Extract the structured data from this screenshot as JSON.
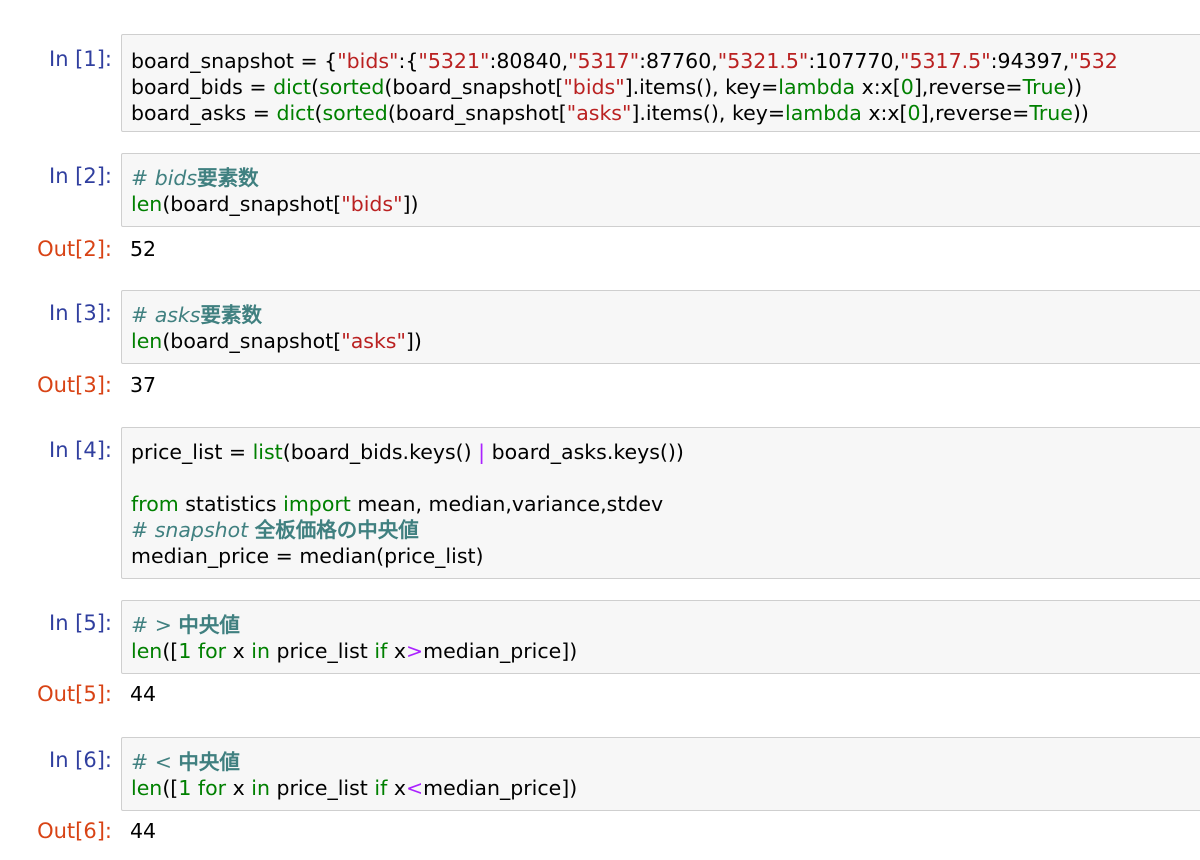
{
  "cells": [
    {
      "prompt": "In [1]:",
      "lines": [
        [
          {
            "t": "board_snapshot = {",
            "c": ""
          },
          {
            "t": "\"bids\"",
            "c": "s"
          },
          {
            "t": ":{",
            "c": ""
          },
          {
            "t": "\"5321\"",
            "c": "s"
          },
          {
            "t": ":80840,",
            "c": ""
          },
          {
            "t": "\"5317\"",
            "c": "s"
          },
          {
            "t": ":87760,",
            "c": ""
          },
          {
            "t": "\"5321.5\"",
            "c": "s"
          },
          {
            "t": ":107770,",
            "c": ""
          },
          {
            "t": "\"5317.5\"",
            "c": "s"
          },
          {
            "t": ":94397,",
            "c": ""
          },
          {
            "t": "\"532",
            "c": "s"
          }
        ],
        [
          {
            "t": "board_bids = ",
            "c": ""
          },
          {
            "t": "dict",
            "c": "b"
          },
          {
            "t": "(",
            "c": ""
          },
          {
            "t": "sorted",
            "c": "b"
          },
          {
            "t": "(board_snapshot[",
            "c": ""
          },
          {
            "t": "\"bids\"",
            "c": "s"
          },
          {
            "t": "].items(), key=",
            "c": ""
          },
          {
            "t": "lambda",
            "c": "k"
          },
          {
            "t": " x:x[",
            "c": ""
          },
          {
            "t": "0",
            "c": "num"
          },
          {
            "t": "],reverse=",
            "c": ""
          },
          {
            "t": "True",
            "c": "k"
          },
          {
            "t": "))",
            "c": ""
          }
        ],
        [
          {
            "t": "board_asks = ",
            "c": ""
          },
          {
            "t": "dict",
            "c": "b"
          },
          {
            "t": "(",
            "c": ""
          },
          {
            "t": "sorted",
            "c": "b"
          },
          {
            "t": "(board_snapshot[",
            "c": ""
          },
          {
            "t": "\"asks\"",
            "c": "s"
          },
          {
            "t": "].items(), key=",
            "c": ""
          },
          {
            "t": "lambda",
            "c": "k"
          },
          {
            "t": " x:x[",
            "c": ""
          },
          {
            "t": "0",
            "c": "num"
          },
          {
            "t": "],reverse=",
            "c": ""
          },
          {
            "t": "True",
            "c": "k"
          },
          {
            "t": "))",
            "c": ""
          }
        ]
      ],
      "output_prompt": "",
      "output": ""
    },
    {
      "prompt": "In [2]:",
      "lines": [
        [
          {
            "t": "# bids",
            "c": "c"
          },
          {
            "t": "要素数",
            "c": "cj"
          }
        ],
        [
          {
            "t": "len",
            "c": "b"
          },
          {
            "t": "(board_snapshot[",
            "c": ""
          },
          {
            "t": "\"bids\"",
            "c": "s"
          },
          {
            "t": "])",
            "c": ""
          }
        ]
      ],
      "output_prompt": "Out[2]:",
      "output": "52"
    },
    {
      "prompt": "In [3]:",
      "lines": [
        [
          {
            "t": "# asks",
            "c": "c"
          },
          {
            "t": "要素数",
            "c": "cj"
          }
        ],
        [
          {
            "t": "len",
            "c": "b"
          },
          {
            "t": "(board_snapshot[",
            "c": ""
          },
          {
            "t": "\"asks\"",
            "c": "s"
          },
          {
            "t": "])",
            "c": ""
          }
        ]
      ],
      "output_prompt": "Out[3]:",
      "output": "37"
    },
    {
      "prompt": "In [4]:",
      "lines": [
        [
          {
            "t": "price_list = ",
            "c": ""
          },
          {
            "t": "list",
            "c": "b"
          },
          {
            "t": "(board_bids.keys() ",
            "c": ""
          },
          {
            "t": "|",
            "c": "o"
          },
          {
            "t": " board_asks.keys())",
            "c": ""
          }
        ],
        [],
        [
          {
            "t": "from",
            "c": "k"
          },
          {
            "t": " statistics ",
            "c": ""
          },
          {
            "t": "import",
            "c": "k"
          },
          {
            "t": " mean, median,variance,stdev",
            "c": ""
          }
        ],
        [
          {
            "t": "# snapshot ",
            "c": "c"
          },
          {
            "t": "全板価格の中央値",
            "c": "cj"
          }
        ],
        [
          {
            "t": "median_price = median(price_list)",
            "c": ""
          }
        ]
      ],
      "output_prompt": "",
      "output": ""
    },
    {
      "prompt": "In [5]:",
      "lines": [
        [
          {
            "t": "# > ",
            "c": "c"
          },
          {
            "t": "中央値",
            "c": "cj"
          }
        ],
        [
          {
            "t": "len",
            "c": "b"
          },
          {
            "t": "([",
            "c": ""
          },
          {
            "t": "1",
            "c": "num"
          },
          {
            "t": " ",
            "c": ""
          },
          {
            "t": "for",
            "c": "k"
          },
          {
            "t": " x ",
            "c": ""
          },
          {
            "t": "in",
            "c": "k"
          },
          {
            "t": " price_list ",
            "c": ""
          },
          {
            "t": "if",
            "c": "k"
          },
          {
            "t": " x",
            "c": ""
          },
          {
            "t": ">",
            "c": "o"
          },
          {
            "t": "median_price])",
            "c": ""
          }
        ]
      ],
      "output_prompt": "Out[5]:",
      "output": "44"
    },
    {
      "prompt": "In [6]:",
      "lines": [
        [
          {
            "t": "# < ",
            "c": "c"
          },
          {
            "t": "中央値",
            "c": "cj"
          }
        ],
        [
          {
            "t": "len",
            "c": "b"
          },
          {
            "t": "([",
            "c": ""
          },
          {
            "t": "1",
            "c": "num"
          },
          {
            "t": " ",
            "c": ""
          },
          {
            "t": "for",
            "c": "k"
          },
          {
            "t": " x ",
            "c": ""
          },
          {
            "t": "in",
            "c": "k"
          },
          {
            "t": " price_list ",
            "c": ""
          },
          {
            "t": "if",
            "c": "k"
          },
          {
            "t": " x",
            "c": ""
          },
          {
            "t": "<",
            "c": "o"
          },
          {
            "t": "median_price])",
            "c": ""
          }
        ]
      ],
      "output_prompt": "Out[6]:",
      "output": "44"
    }
  ]
}
